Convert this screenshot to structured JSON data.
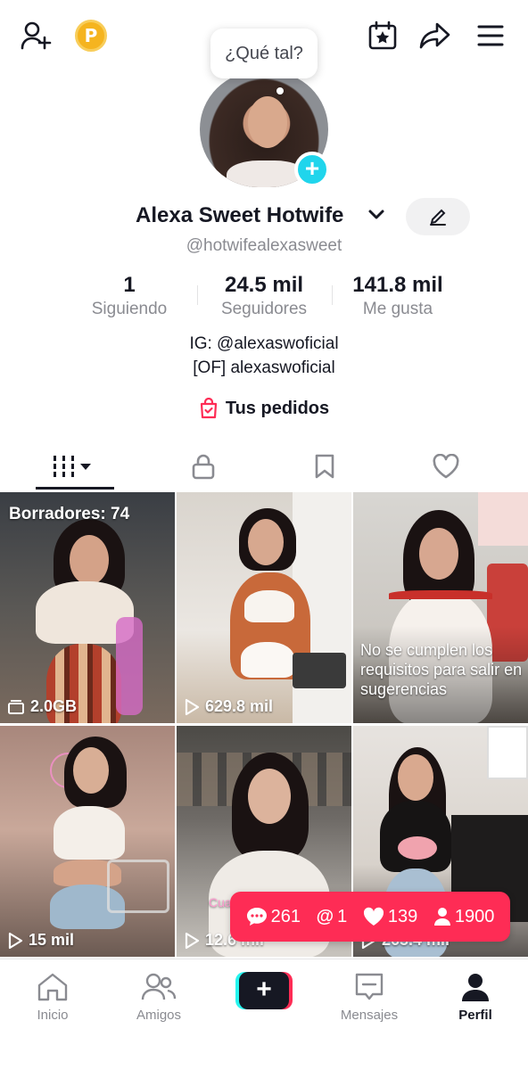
{
  "bubble_text": "¿Qué tal?",
  "profile": {
    "name": "Alexa Sweet Hotwife",
    "handle": "@hotwifealexasweet",
    "bio_lines": [
      "IG: @alexaswoficial",
      "[OF] alexaswoficial"
    ],
    "orders_label": "Tus pedidos"
  },
  "stats": [
    {
      "value": "1",
      "label": "Siguiendo"
    },
    {
      "value": "24.5 mil",
      "label": "Seguidores"
    },
    {
      "value": "141.8 mil",
      "label": "Me gusta"
    }
  ],
  "videos": [
    {
      "overlay": "Borradores: 74",
      "views": "2.0GB",
      "views_icon": "folder-icon"
    },
    {
      "overlay": "",
      "views": "629.8 mil",
      "views_icon": "play-icon"
    },
    {
      "overlay": "No se cumplen los requisitos para salir en sugerencias",
      "views": "",
      "views_icon": ""
    },
    {
      "overlay": "",
      "views": "15 mil",
      "views_icon": "play-icon"
    },
    {
      "overlay": "Cua",
      "views": "12.6 mil",
      "views_icon": "play-icon"
    },
    {
      "overlay": "",
      "views": "265.4 mil",
      "views_icon": "play-icon"
    }
  ],
  "notification": {
    "comments": "261",
    "mentions": "1",
    "likes": "139",
    "followers": "1900"
  },
  "nav": {
    "home": "Inicio",
    "friends": "Amigos",
    "inbox": "Mensajes",
    "profile": "Perfil"
  },
  "colors": {
    "accent": "#fe2c55",
    "cyan": "#20d5ec",
    "coin": "#f5b41f"
  }
}
